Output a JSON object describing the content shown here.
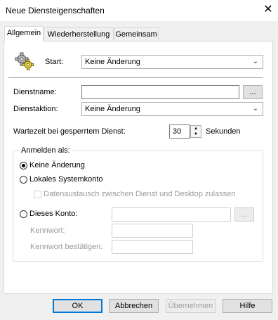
{
  "window": {
    "title": "Neue Diensteigenschaften"
  },
  "tabs": [
    "Allgemein",
    "Wiederherstellung",
    "Gemeinsam"
  ],
  "general": {
    "start_label": "Start:",
    "start_value": "Keine Änderung",
    "service_name_label": "Dienstname:",
    "service_name_value": "",
    "browse_label": "...",
    "service_action_label": "Dienstaktion:",
    "service_action_value": "Keine Änderung",
    "wait_label": "Wartezeit bei gesperrtem Dienst:",
    "wait_value": "30",
    "wait_unit": "Sekunden"
  },
  "logon": {
    "group_label": "Anmelden als:",
    "option_no_change": "Keine Änderung",
    "option_local_system": "Lokales Systemkonto",
    "desktop_interact": "Datenaustausch zwischen Dienst und Desktop zulassen",
    "option_this_account": "Dieses Konto:",
    "account_browse": "...",
    "password_label": "Kennwort:",
    "confirm_label": "Kennwort bestätigen:"
  },
  "buttons": {
    "ok": "OK",
    "cancel": "Abbrechen",
    "apply": "Übernehmen",
    "help": "Hilfe"
  }
}
